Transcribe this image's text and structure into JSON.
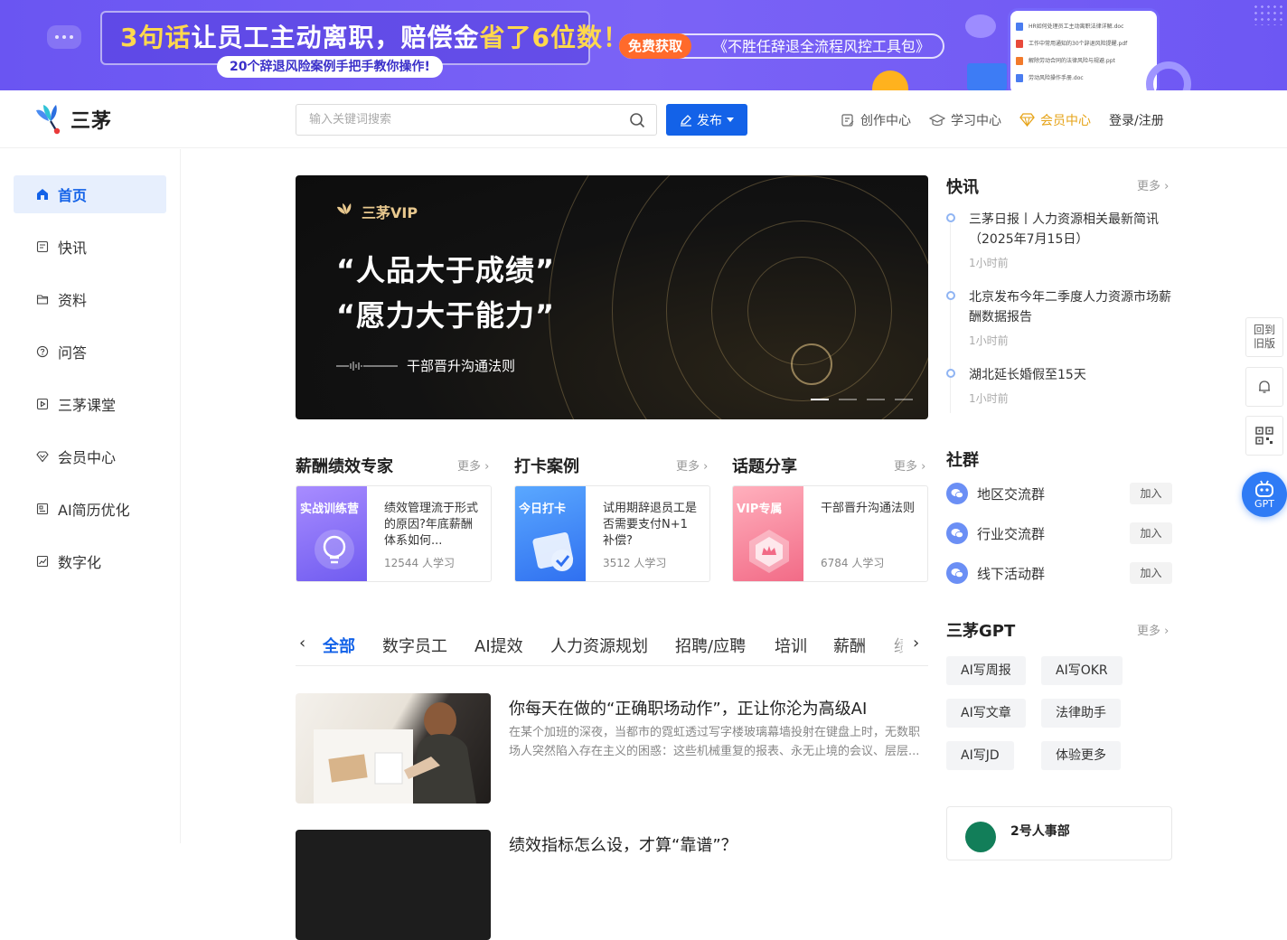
{
  "ad": {
    "headline_pre": "3句话",
    "headline_mid": "让员工主动离职，赔偿金",
    "headline_hl": "省了6位数！",
    "subline": "20个辞退风险案例手把手教你操作!",
    "cta_free": "免费获取",
    "cta_tool": "《不胜任辞退全流程风控工具包》",
    "docs": [
      "HR如何处理员工主动离职法律详解.doc",
      "工作中常用通知的30个辞退风险提醒.pdf",
      "解除劳动合同的法律风险与规避.ppt",
      "劳动风险操作手册.doc"
    ]
  },
  "header": {
    "logo_text": "三茅",
    "search_placeholder": "输入关键词搜索",
    "publish_label": "发布",
    "nav": [
      {
        "label": "创作中心",
        "icon": "edit-doc-icon"
      },
      {
        "label": "学习中心",
        "icon": "graduation-cap-icon"
      },
      {
        "label": "会员中心",
        "icon": "diamond-icon"
      }
    ],
    "login_label": "登录/注册"
  },
  "sidebar": {
    "items": [
      {
        "label": "首页",
        "icon": "home-icon",
        "active": true
      },
      {
        "label": "快讯",
        "icon": "news-icon"
      },
      {
        "label": "资料",
        "icon": "folder-icon"
      },
      {
        "label": "问答",
        "icon": "question-icon"
      },
      {
        "label": "三茅课堂",
        "icon": "play-icon"
      },
      {
        "label": "会员中心",
        "icon": "diamond-icon"
      },
      {
        "label": "AI简历优化",
        "icon": "resume-icon"
      },
      {
        "label": "数字化",
        "icon": "chart-icon"
      }
    ]
  },
  "hero": {
    "brand": "三茅VIP",
    "quote1": "“人品大于成绩”",
    "quote2": "“愿力大于能力”",
    "course": "干部晋升沟通法则",
    "slides": 4,
    "active_slide": 1
  },
  "sections": [
    {
      "title": "薪酬绩效专家",
      "more": "更多",
      "card": {
        "tag": "实战训练营",
        "title": "绩效管理流于形式的原因?年底薪酬体系如何...",
        "learners": "12544 人学习"
      }
    },
    {
      "title": "打卡案例",
      "more": "更多",
      "card": {
        "tag": "今日打卡",
        "title": "试用期辞退员工是否需要支付N+1 补偿?",
        "learners": "3512 人学习"
      }
    },
    {
      "title": "话题分享",
      "more": "更多",
      "card": {
        "tag": "VIP专属",
        "title": "干部晋升沟通法则",
        "learners": "6784 人学习"
      }
    }
  ],
  "tabs": {
    "prev": "‹",
    "next": "›",
    "items": [
      "全部",
      "数字员工",
      "AI提效",
      "人力资源规划",
      "招聘/应聘",
      "培训",
      "薪酬",
      "绩"
    ],
    "active": 0
  },
  "articles": [
    {
      "title": "你每天在做的“正确职场动作”，正让你沦为高级AI",
      "desc": "在某个加班的深夜，当都市的霓虹透过写字楼玻璃幕墙投射在键盘上时，无数职场人突然陷入存在主义的困惑：这些机械重复的报表、永无止境的会议、层层..."
    },
    {
      "title": "绩效指标怎么设，才算“靠谱”？",
      "desc": ""
    }
  ],
  "news": {
    "title": "快讯",
    "more": "更多",
    "items": [
      {
        "title": "三茅日报丨人力资源相关最新简讯（2025年7月15日）",
        "time": "1小时前"
      },
      {
        "title": "北京发布今年二季度人力资源市场薪酬数据报告",
        "time": "1小时前"
      },
      {
        "title": "湖北延长婚假至15天",
        "time": "1小时前"
      }
    ]
  },
  "community": {
    "title": "社群",
    "groups": [
      {
        "name": "地区交流群",
        "join": "加入"
      },
      {
        "name": "行业交流群",
        "join": "加入"
      },
      {
        "name": "线下活动群",
        "join": "加入"
      }
    ]
  },
  "gpt": {
    "title": "三茅GPT",
    "more": "更多",
    "tools": [
      "AI写周报",
      "AI写OKR",
      "AI写文章",
      "法律助手",
      "AI写JD",
      "体验更多"
    ]
  },
  "promo": {
    "title": "2号人事部"
  },
  "floating": {
    "old_version": "回到旧版",
    "gpt_label": "GPT"
  },
  "colors": {
    "brand_blue": "#1362e8",
    "vip_gold": "#e6a317",
    "ad_purple": "#6a55f2"
  }
}
